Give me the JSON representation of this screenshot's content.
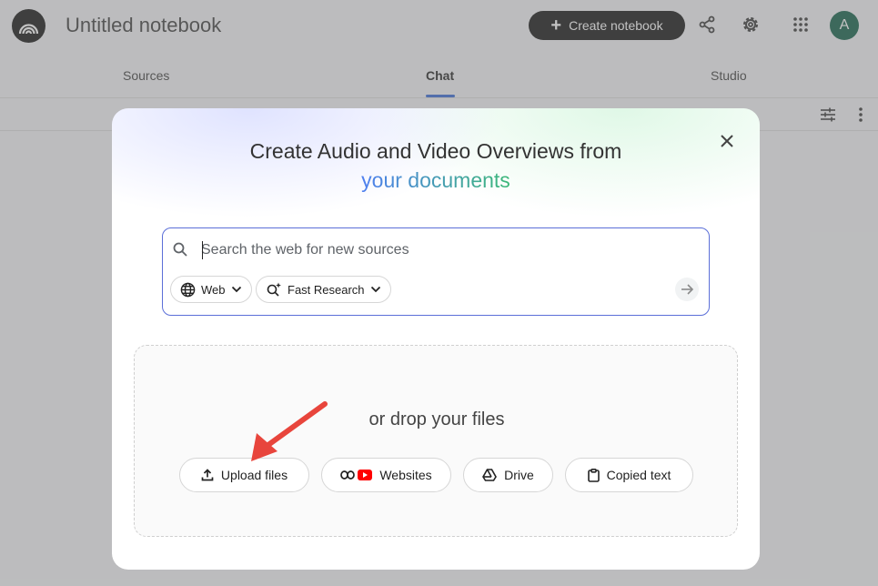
{
  "header": {
    "title": "Untitled notebook",
    "create_label": "Create notebook",
    "avatar_letter": "A"
  },
  "tabs": [
    {
      "label": "Sources"
    },
    {
      "label": "Chat"
    },
    {
      "label": "Studio"
    }
  ],
  "modal": {
    "headline_line1": "Create Audio and Video Overviews from",
    "headline_line2": "your documents",
    "search": {
      "placeholder": "Search the web for new sources"
    },
    "chips": {
      "web": "Web",
      "research": "Fast Research"
    },
    "drop_text": "or drop your files",
    "sources": [
      {
        "label": "Upload files",
        "icon": "upload-icon"
      },
      {
        "label": "Websites",
        "icon": "link-youtube-icon"
      },
      {
        "label": "Drive",
        "icon": "drive-icon"
      },
      {
        "label": "Copied text",
        "icon": "clipboard-icon"
      }
    ]
  },
  "colors": {
    "accent": "#3367d6",
    "avatar": "#0d5e45",
    "annotation_arrow": "#e8453c"
  }
}
